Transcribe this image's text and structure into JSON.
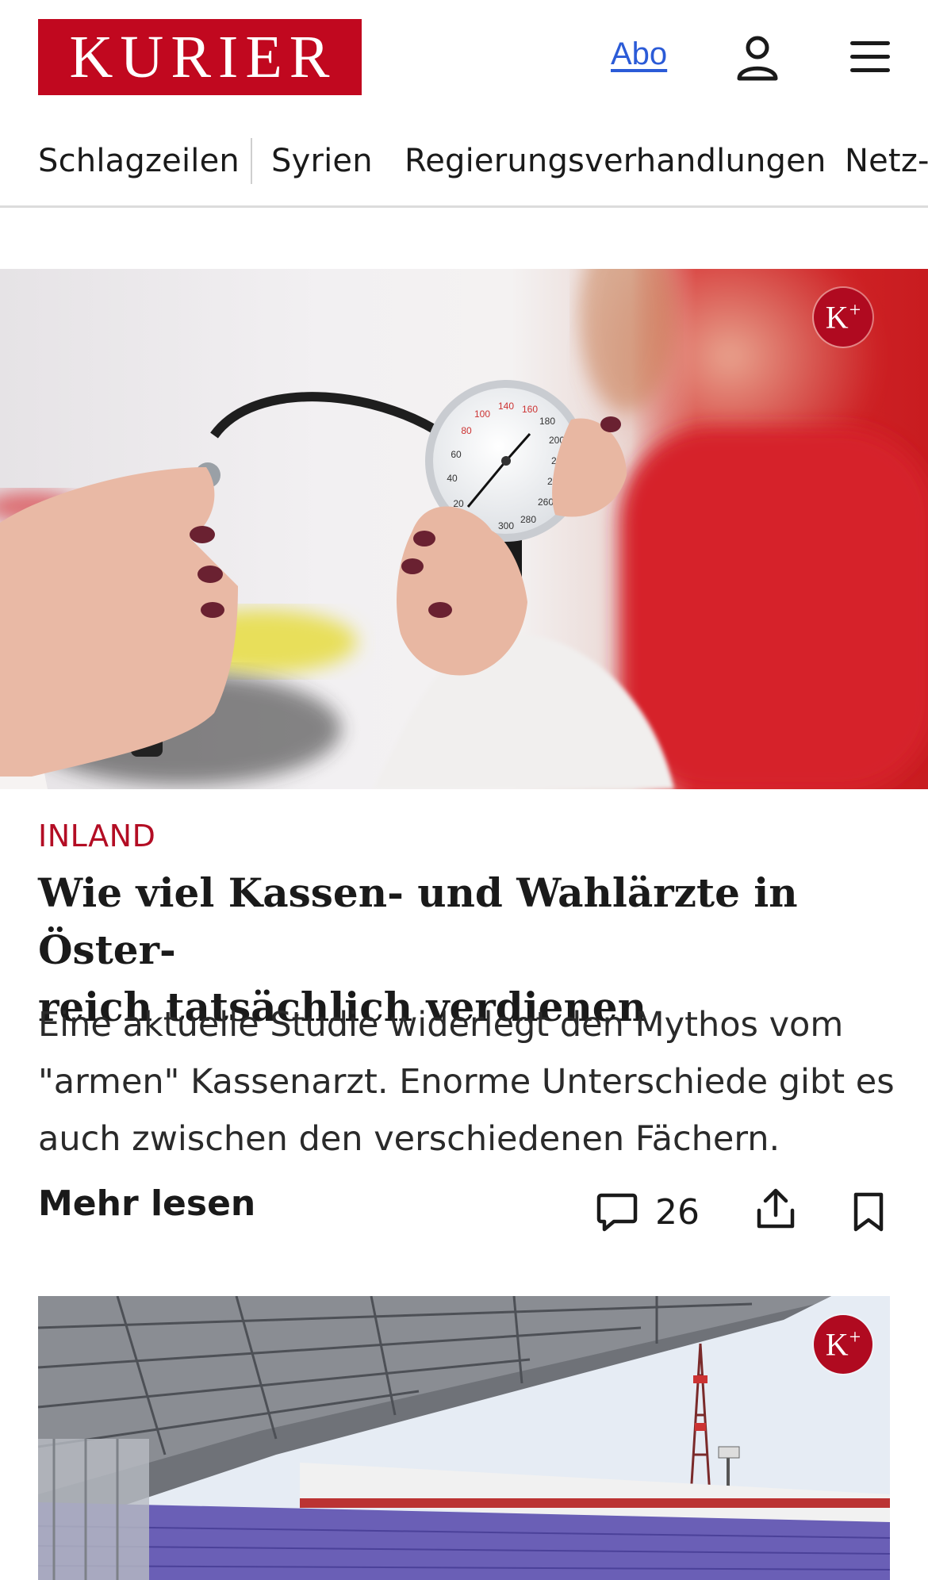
{
  "header": {
    "logo_text": "KURIER",
    "abo_label": "Abo",
    "user_icon": "user-icon",
    "menu_icon": "hamburger-menu-icon",
    "brand_color": "#c1081f"
  },
  "nav": {
    "items": [
      {
        "label": "Schlagzeilen"
      },
      {
        "label": "Syrien"
      },
      {
        "label": "Regierungsverhandlungen"
      },
      {
        "label": "Netz-"
      }
    ]
  },
  "article1": {
    "premium_badge": "K+",
    "category": "INLAND",
    "headline_line1": "Wie viel Kassen- und Wahlärzte in Öster-",
    "headline_line2": "reich tatsächlich verdienen",
    "teaser": "Eine aktuelle Studie widerlegt den Mythos vom \"armen\" Kassenarzt. Enorme Unterschiede gibt es auch zwischen den verschiedenen Fächern.",
    "more_label": "Mehr lesen",
    "comment_count": "26",
    "comment_icon": "comment-icon",
    "share_icon": "share-icon",
    "bookmark_icon": "bookmark-icon"
  },
  "article2": {
    "premium_badge": "K+"
  }
}
